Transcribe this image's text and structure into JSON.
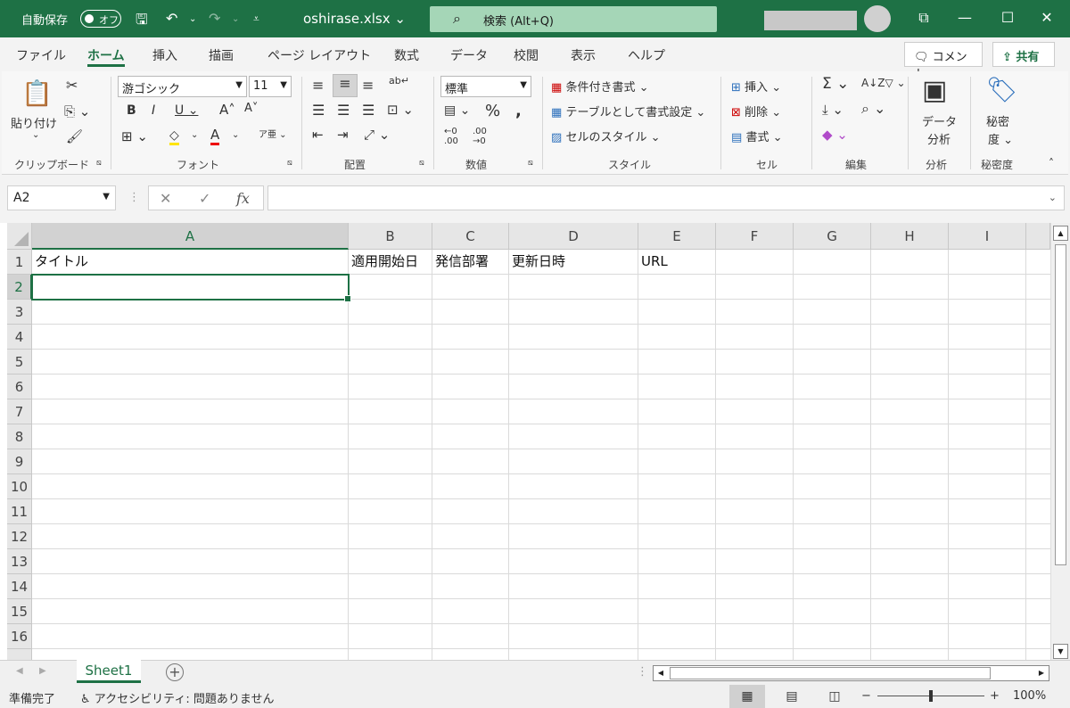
{
  "titlebar": {
    "autosave_label": "自動保存",
    "toggle_label": "オフ",
    "filename": "oshirase.xlsx",
    "search_placeholder": "検索 (Alt+Q)"
  },
  "tabs": [
    "ファイル",
    "ホーム",
    "挿入",
    "描画",
    "ページ レイアウト",
    "数式",
    "データ",
    "校閲",
    "表示",
    "ヘルプ"
  ],
  "active_tab": "ホーム",
  "ribbon_actions": {
    "comment": "コメント",
    "share": "共有"
  },
  "ribbon": {
    "clipboard": {
      "paste": "貼り付け",
      "label": "クリップボード"
    },
    "font": {
      "name": "游ゴシック",
      "size": "11",
      "label": "フォント"
    },
    "alignment": {
      "label": "配置"
    },
    "number": {
      "format": "標準",
      "label": "数値"
    },
    "styles": {
      "conditional": "条件付き書式",
      "table": "テーブルとして書式設定",
      "cell_styles": "セルのスタイル",
      "label": "スタイル"
    },
    "cells": {
      "insert": "挿入",
      "delete": "削除",
      "format": "書式",
      "label": "セル"
    },
    "editing": {
      "label": "編集"
    },
    "analysis": {
      "button": "データ\n分析",
      "btn_l1": "データ",
      "btn_l2": "分析",
      "label": "分析"
    },
    "sensitivity": {
      "btn_l1": "秘密",
      "btn_l2": "度",
      "label": "秘密度"
    }
  },
  "formula_bar": {
    "namebox": "A2",
    "cancel": "✕",
    "enter": "✓",
    "fx": "fx",
    "content": ""
  },
  "grid": {
    "columns": [
      "A",
      "B",
      "C",
      "D",
      "E",
      "F",
      "G",
      "H",
      "I"
    ],
    "rows": [
      "1",
      "2",
      "3",
      "4",
      "5",
      "6",
      "7",
      "8",
      "9",
      "10",
      "11",
      "12",
      "13",
      "14",
      "15",
      "16"
    ],
    "header_row": [
      "タイトル",
      "適用開始日",
      "発信部署",
      "更新日時",
      "URL"
    ],
    "selected_cell": "A2"
  },
  "sheets": [
    "Sheet1"
  ],
  "status": {
    "ready": "準備完了",
    "accessibility": "アクセシビリティ: 問題ありません",
    "zoom": "100%"
  },
  "colors": {
    "accent": "#1e7145",
    "search_bg": "#a5d6b7"
  }
}
